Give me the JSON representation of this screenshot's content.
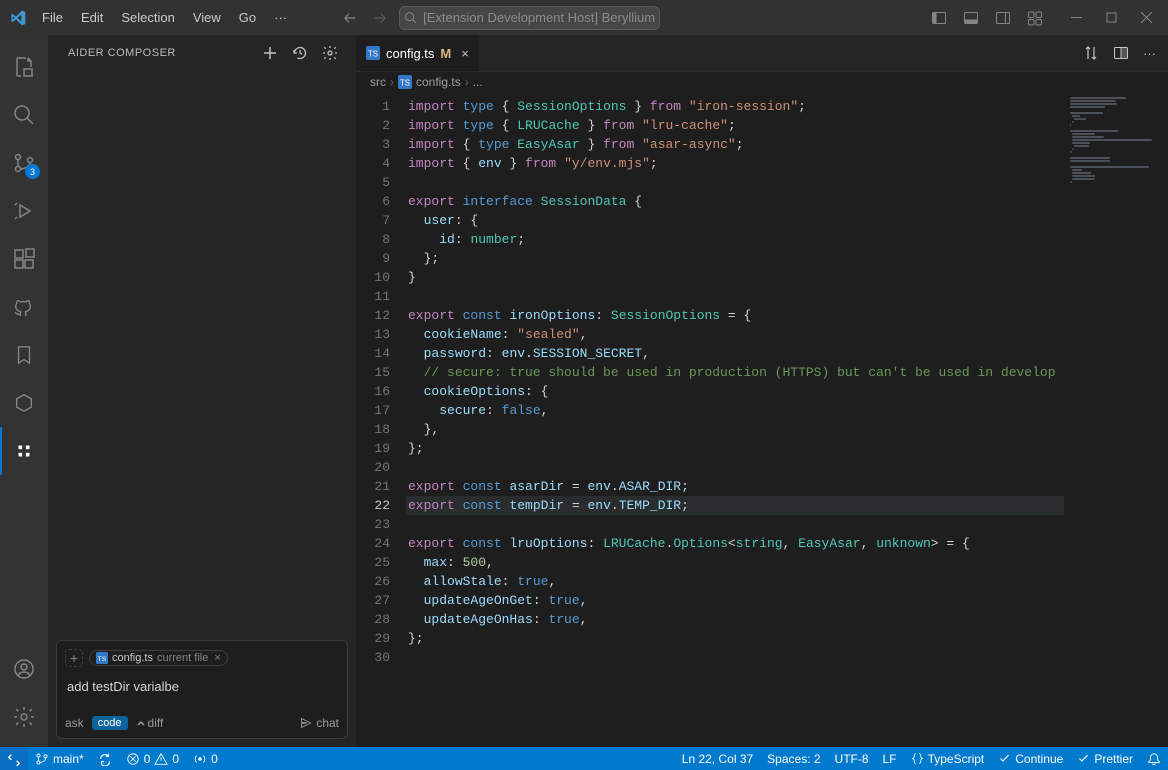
{
  "titlebar": {
    "menus": [
      "File",
      "Edit",
      "Selection",
      "View",
      "Go",
      "···"
    ],
    "search_label": "[Extension Development Host] Beryllium"
  },
  "activity": {
    "scm_badge": "3"
  },
  "sidebar": {
    "title": "AIDER COMPOSER",
    "chip": {
      "file": "config.ts",
      "sub": "current file"
    },
    "input_text": "add testDir varialbe",
    "mode_ask": "ask",
    "mode_code": "code",
    "mode_diff": "diff",
    "chat_label": "chat"
  },
  "editor": {
    "tab": {
      "name": "config.ts",
      "modified": "M"
    },
    "breadcrumb": {
      "seg1": "src",
      "seg2": "config.ts",
      "seg3": "..."
    },
    "lines": [
      1,
      2,
      3,
      4,
      5,
      6,
      7,
      8,
      9,
      10,
      11,
      12,
      13,
      14,
      15,
      16,
      17,
      18,
      19,
      20,
      21,
      22,
      23,
      24,
      25,
      26,
      27,
      28,
      29,
      30
    ],
    "current_line": 22,
    "code": {
      "l1": {
        "raw": "import type { SessionOptions } from \"iron-session\";"
      },
      "l2": {
        "raw": "import type { LRUCache } from \"lru-cache\";"
      },
      "l3": {
        "raw": "import { type EasyAsar } from \"asar-async\";"
      },
      "l4": {
        "raw": "import { env } from \"y/env.mjs\";"
      },
      "l5": {
        "raw": ""
      },
      "l6": {
        "raw": "export interface SessionData {"
      },
      "l7": {
        "raw": "  user: {"
      },
      "l8": {
        "raw": "    id: number;"
      },
      "l9": {
        "raw": "  };"
      },
      "l10": {
        "raw": "}"
      },
      "l11": {
        "raw": ""
      },
      "l12": {
        "raw": "export const ironOptions: SessionOptions = {"
      },
      "l13": {
        "raw": "  cookieName: \"sealed\","
      },
      "l14": {
        "raw": "  password: env.SESSION_SECRET,"
      },
      "l15": {
        "raw": "  // secure: true should be used in production (HTTPS) but can't be used in develop"
      },
      "l16": {
        "raw": "  cookieOptions: {"
      },
      "l17": {
        "raw": "    secure: false,"
      },
      "l18": {
        "raw": "  },"
      },
      "l19": {
        "raw": "};"
      },
      "l20": {
        "raw": ""
      },
      "l21": {
        "raw": "export const asarDir = env.ASAR_DIR;"
      },
      "l22": {
        "raw": "export const tempDir = env.TEMP_DIR;"
      },
      "l23": {
        "raw": ""
      },
      "l24": {
        "raw": "export const lruOptions: LRUCache.Options<string, EasyAsar, unknown> = {"
      },
      "l25": {
        "raw": "  max: 500,"
      },
      "l26": {
        "raw": "  allowStale: true,"
      },
      "l27": {
        "raw": "  updateAgeOnGet: true,"
      },
      "l28": {
        "raw": "  updateAgeOnHas: true,"
      },
      "l29": {
        "raw": "};"
      },
      "l30": {
        "raw": ""
      }
    }
  },
  "status": {
    "branch": "main*",
    "sync": "",
    "errors": "0",
    "warnings": "0",
    "ports": "0",
    "ln_col": "Ln 22, Col 37",
    "spaces": "Spaces: 2",
    "encoding": "UTF-8",
    "eol": "LF",
    "lang": "TypeScript",
    "continue": "Continue",
    "prettier": "Prettier"
  }
}
